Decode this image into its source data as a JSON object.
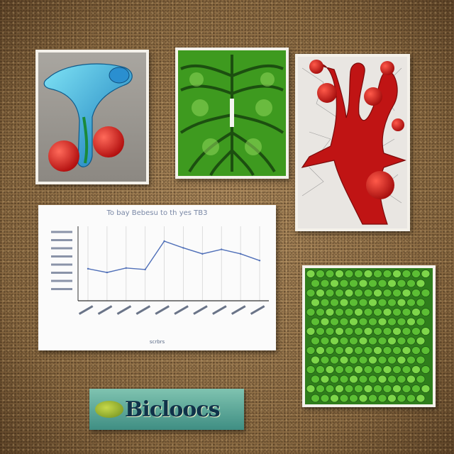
{
  "badge": {
    "text": "Bicloocs"
  },
  "chart": {
    "title": "To bay Bebesu to th yes TB3",
    "xlabel": "scrbrs"
  },
  "chart_data": {
    "type": "line",
    "title": "To bay Bebesu to th yes TB3",
    "x": [
      0,
      1,
      2,
      3,
      4,
      5,
      6,
      7,
      8,
      9
    ],
    "y": [
      4.3,
      3.8,
      4.4,
      4.2,
      8.0,
      7.1,
      6.3,
      6.9,
      6.3,
      5.4
    ],
    "ylim": [
      0,
      10
    ],
    "grid": true,
    "series_color": "#4f6fb8"
  },
  "colors": {
    "cork": "#9a7a52",
    "anatomy_blue": "#2aa0c8",
    "anatomy_red": "#d71a1a",
    "leaf_green": "#4faa25",
    "vessel_red": "#c41616",
    "cell_green": "#3fa82a"
  }
}
